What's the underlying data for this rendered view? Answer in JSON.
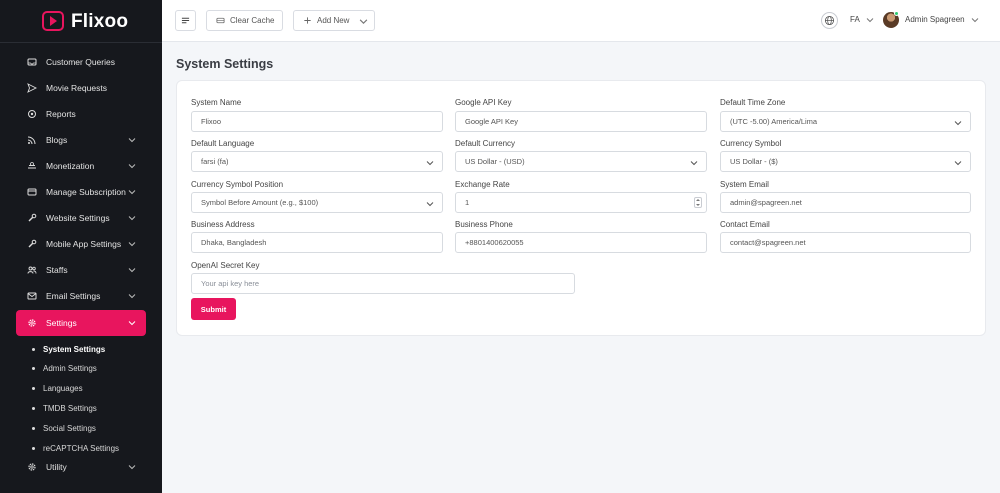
{
  "brand": {
    "name": "Flixoo",
    "accent": "#e8155e"
  },
  "sidebar": {
    "items": [
      {
        "label": "Customer Queries",
        "icon": "inbox-icon",
        "has_children": false
      },
      {
        "label": "Movie Requests",
        "icon": "send-icon",
        "has_children": false
      },
      {
        "label": "Reports",
        "icon": "settings-alt-icon",
        "has_children": false
      },
      {
        "label": "Blogs",
        "icon": "rss-icon",
        "has_children": true
      },
      {
        "label": "Monetization",
        "icon": "coin-icon",
        "has_children": true
      },
      {
        "label": "Manage Subscription",
        "icon": "card-icon",
        "has_children": true
      },
      {
        "label": "Website Settings",
        "icon": "wrench-icon",
        "has_children": true
      },
      {
        "label": "Mobile App Settings",
        "icon": "wrench-icon",
        "has_children": true
      },
      {
        "label": "Staffs",
        "icon": "users-icon",
        "has_children": true
      },
      {
        "label": "Email Settings",
        "icon": "mail-icon",
        "has_children": true
      },
      {
        "label": "Settings",
        "icon": "gear-icon",
        "has_children": true,
        "active": true
      },
      {
        "label": "Utility",
        "icon": "gear-icon",
        "has_children": true
      }
    ],
    "settings_sub": [
      {
        "label": "System Settings",
        "current": true
      },
      {
        "label": "Admin Settings"
      },
      {
        "label": "Languages"
      },
      {
        "label": "TMDB Settings"
      },
      {
        "label": "Social Settings"
      },
      {
        "label": "reCAPTCHA Settings"
      }
    ]
  },
  "topbar": {
    "clear_cache": "Clear Cache",
    "add_new": "Add New",
    "language": "FA",
    "user_name": "Admin Spagreen"
  },
  "page": {
    "title": "System Settings"
  },
  "form": {
    "system_name": {
      "label": "System Name",
      "value": "Flixoo"
    },
    "google_api_key": {
      "label": "Google API Key",
      "value": "Google API Key"
    },
    "default_time_zone": {
      "label": "Default Time Zone",
      "value": "(UTC -5.00) America/Lima"
    },
    "default_language": {
      "label": "Default Language",
      "value": "farsi (fa)"
    },
    "default_currency": {
      "label": "Default Currency",
      "value": "US Dollar - (USD)"
    },
    "currency_symbol": {
      "label": "Currency Symbol",
      "value": "US Dollar - ($)"
    },
    "currency_symbol_position": {
      "label": "Currency Symbol Position",
      "value": "Symbol Before Amount (e.g., $100)"
    },
    "exchange_rate": {
      "label": "Exchange Rate",
      "value": "1"
    },
    "system_email": {
      "label": "System Email",
      "value": "admin@spagreen.net"
    },
    "business_address": {
      "label": "Business Address",
      "value": "Dhaka, Bangladesh"
    },
    "business_phone": {
      "label": "Business Phone",
      "value": "+8801400620055"
    },
    "contact_email": {
      "label": "Contact Email",
      "value": "contact@spagreen.net"
    },
    "openai_secret_key": {
      "label": "OpenAI Secret Key",
      "placeholder": "Your api key here"
    },
    "submit_label": "Submit"
  }
}
